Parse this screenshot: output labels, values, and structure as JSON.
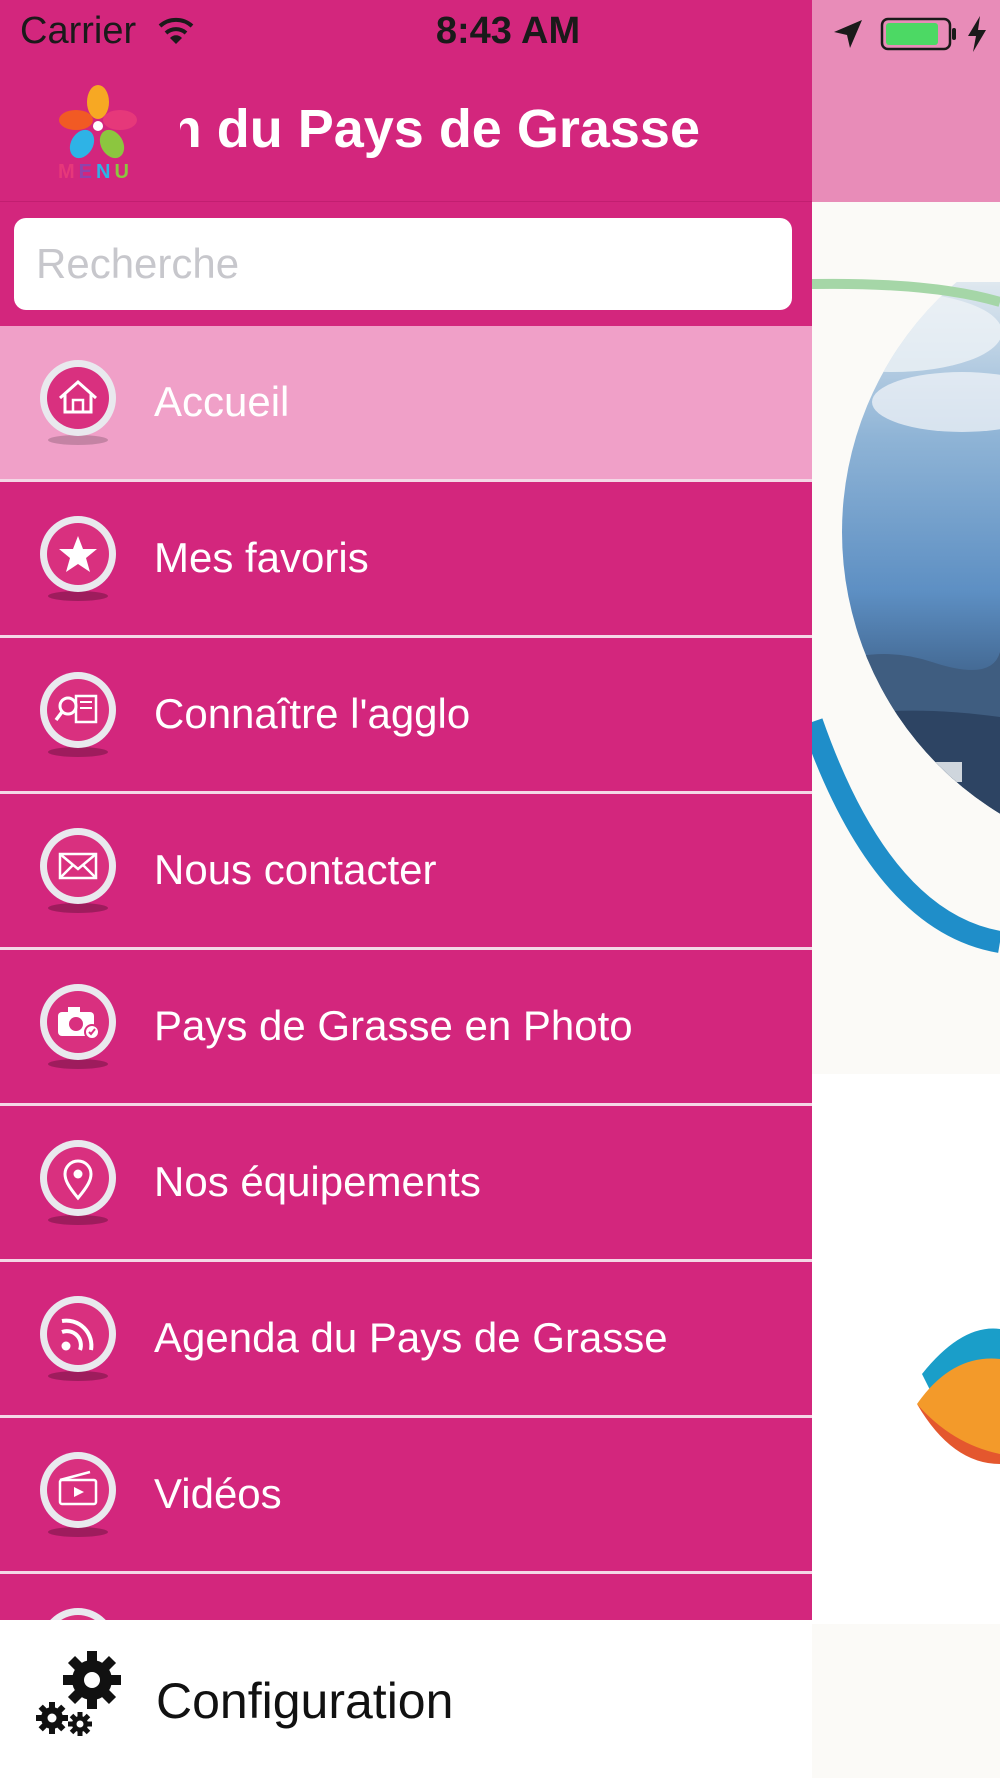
{
  "status_bar": {
    "carrier": "Carrier",
    "time": "8:43 AM",
    "icons": [
      "wifi-icon",
      "location-arrow-icon",
      "battery-icon",
      "charging-bolt-icon"
    ],
    "battery_color": "#4cd964"
  },
  "header": {
    "logo_text": "MENU",
    "title": "Agglomération du Pays de Grasse",
    "title_visible": "n du Pays de Grasse"
  },
  "search": {
    "placeholder": "Recherche",
    "value": ""
  },
  "menu": {
    "items": [
      {
        "label": "Accueil",
        "icon": "home-icon",
        "selected": true
      },
      {
        "label": "Mes favoris",
        "icon": "star-icon",
        "selected": false
      },
      {
        "label": "Connaître l'agglo",
        "icon": "search-book-icon",
        "selected": false
      },
      {
        "label": "Nous contacter",
        "icon": "envelope-icon",
        "selected": false
      },
      {
        "label": "Pays de Grasse en Photo",
        "icon": "camera-icon",
        "selected": false
      },
      {
        "label": "Nos équipements",
        "icon": "map-pin-icon",
        "selected": false
      },
      {
        "label": "Agenda du Pays de Grasse",
        "icon": "rss-icon",
        "selected": false
      },
      {
        "label": "Vidéos",
        "icon": "video-icon",
        "selected": false
      }
    ]
  },
  "footer": {
    "config_label": "Configuration",
    "icon": "gears-icon"
  },
  "colors": {
    "menu_bg": "#d3267d",
    "selected_bg": "#f0a0c8",
    "bg_header": "#e88cb8",
    "divider": "#f4d7e6"
  }
}
